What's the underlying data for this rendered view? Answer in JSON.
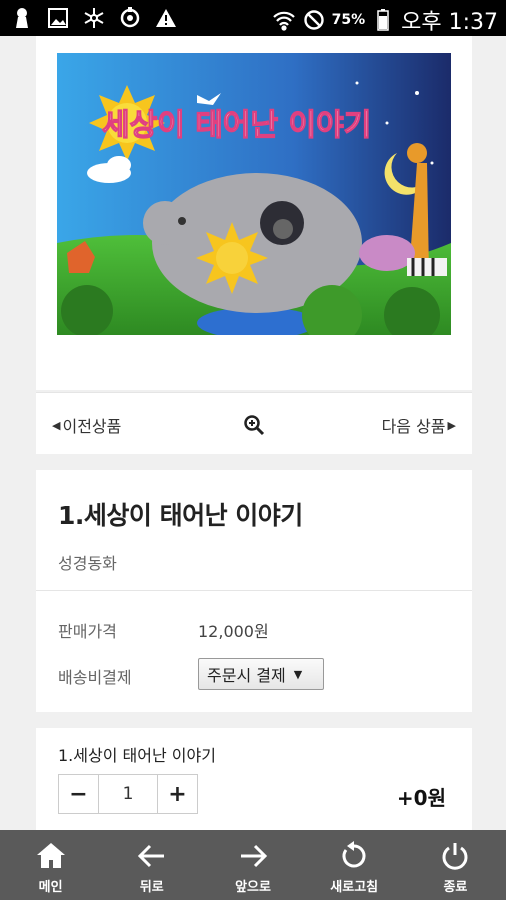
{
  "status_bar": {
    "battery_percent": "75%",
    "time": "오후 1:37"
  },
  "product_image": {
    "banner_title": "세상이 태어난 이야기"
  },
  "product_nav": {
    "prev_label": "이전상품",
    "next_label": "다음 상품"
  },
  "product_info": {
    "title": "1.세상이 태어난 이야기",
    "category": "성경동화",
    "price_label": "판매가격",
    "price_value": "12,000원",
    "shipping_label": "배송비결제",
    "shipping_selected": "주문시 결제"
  },
  "order": {
    "item_name": "1.세상이 태어난 이야기",
    "quantity": "1",
    "minus": "−",
    "plus": "+",
    "added_price": "+0원"
  },
  "bottom_bar": {
    "items": [
      {
        "label": "메인",
        "icon": "home-icon"
      },
      {
        "label": "뒤로",
        "icon": "arrow-left-icon"
      },
      {
        "label": "앞으로",
        "icon": "arrow-right-icon"
      },
      {
        "label": "새로고침",
        "icon": "refresh-icon"
      },
      {
        "label": "종료",
        "icon": "power-icon"
      }
    ]
  }
}
